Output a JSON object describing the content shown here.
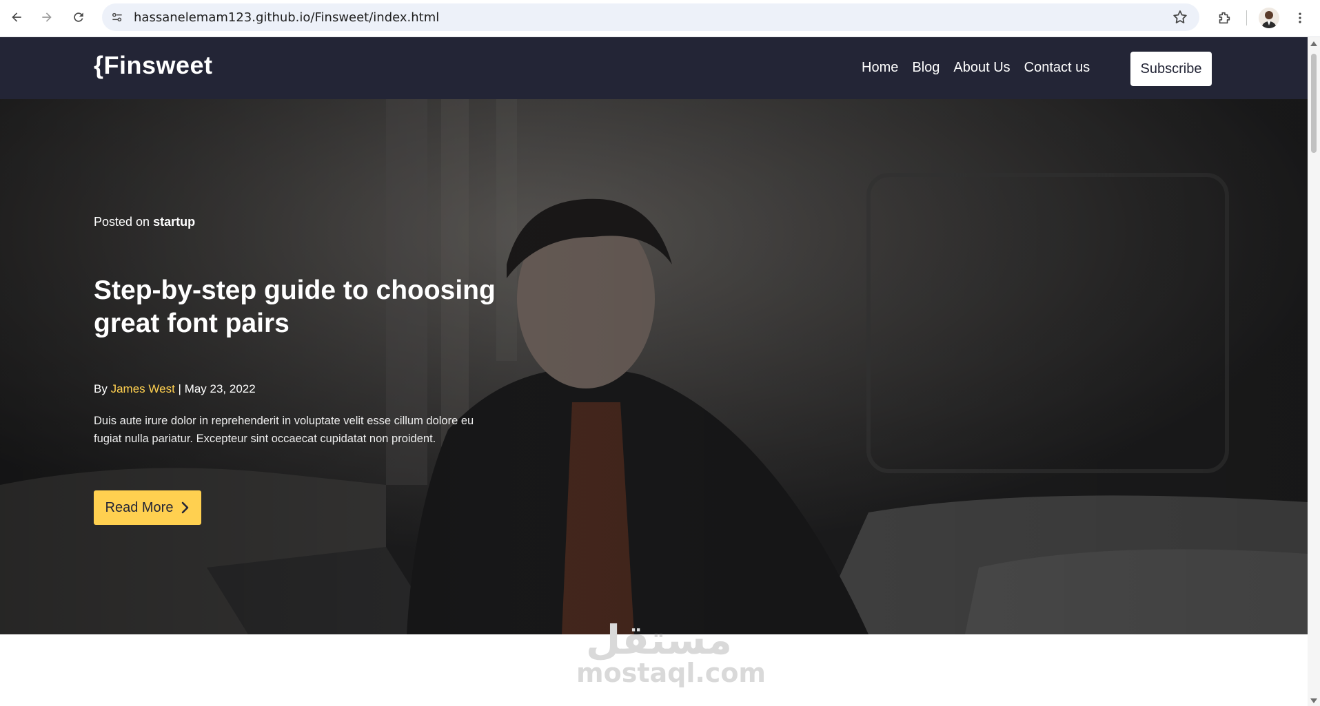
{
  "browser": {
    "url": "hassanelemam123.github.io/Finsweet/index.html",
    "icons": [
      "back-icon",
      "forward-icon",
      "reload-icon",
      "site-settings-icon",
      "star-icon",
      "extensions-icon",
      "profile-avatar",
      "menu-icon"
    ]
  },
  "header": {
    "logo": "{Finsweet",
    "nav": [
      "Home",
      "Blog",
      "About Us",
      "Contact us"
    ],
    "subscribe_label": "Subscribe",
    "bg_color": "#232536"
  },
  "hero": {
    "posted_prefix": "Posted on",
    "category": "startup",
    "title": "Step-by-step guide to choosing great font pairs",
    "by_prefix": "By",
    "author": "James West",
    "separator": "|",
    "date": "May 23, 2022",
    "excerpt": "Duis aute irure dolor in reprehenderit in voluptate velit esse cillum dolore eu fugiat nulla pariatur. Excepteur sint occaecat cupidatat non proident.",
    "cta_label": "Read More",
    "accent_color": "#ffd050"
  },
  "watermark": {
    "arabic": "مستقل",
    "latin": "mostaql.com"
  }
}
